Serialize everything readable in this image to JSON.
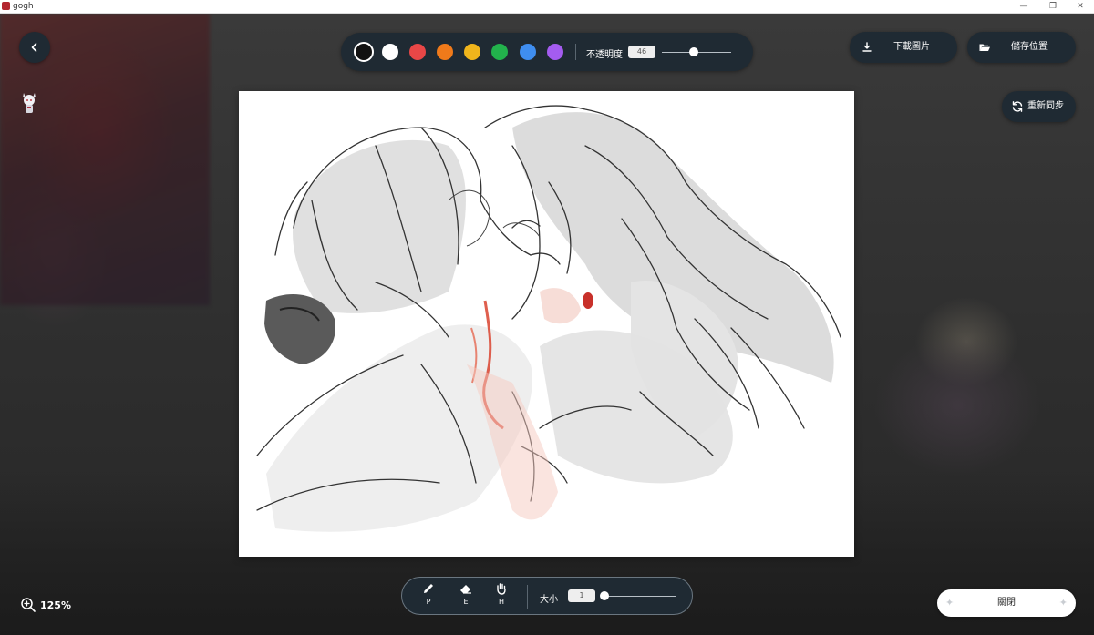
{
  "window": {
    "title": "gogh",
    "controls": [
      "—",
      "❐",
      "✕"
    ]
  },
  "palette": {
    "colors": [
      {
        "name": "black",
        "hex": "#111111",
        "selected": true
      },
      {
        "name": "white",
        "hex": "#ffffff",
        "selected": false
      },
      {
        "name": "red",
        "hex": "#e84747",
        "selected": false
      },
      {
        "name": "orange",
        "hex": "#f07a1a",
        "selected": false
      },
      {
        "name": "yellow",
        "hex": "#f0b51c",
        "selected": false
      },
      {
        "name": "green",
        "hex": "#22b24c",
        "selected": false
      },
      {
        "name": "blue",
        "hex": "#3f8ef0",
        "selected": false
      },
      {
        "name": "purple",
        "hex": "#a45cf0",
        "selected": false
      }
    ],
    "opacity_label": "不透明度",
    "opacity_value": "46",
    "opacity_fraction": 0.46
  },
  "actions": {
    "download_label": "下載圖片",
    "save_location_label": "儲存位置",
    "resync_label": "重新同步"
  },
  "tools": {
    "pen_key": "P",
    "eraser_key": "E",
    "hand_key": "H",
    "size_label": "大小",
    "size_value": "1",
    "size_fraction": 0.0
  },
  "zoom": {
    "value": "125%"
  },
  "close_label": "關閉",
  "accent_colors": {
    "toolbar_bg": "#1f2a33",
    "canvas_bg": "#ffffff"
  }
}
